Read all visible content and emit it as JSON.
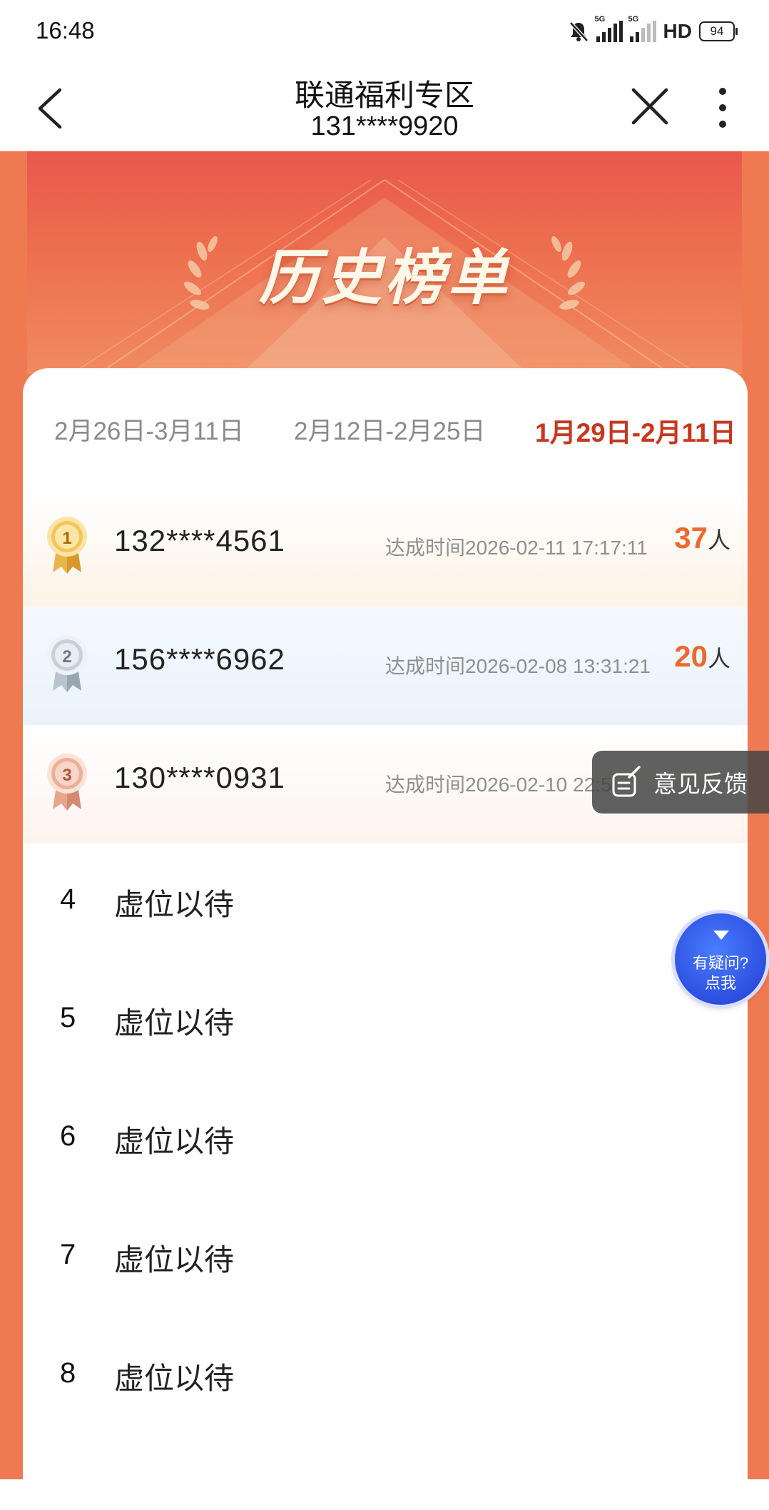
{
  "status_bar": {
    "time": "16:48",
    "network_1": "5G",
    "network_2": "5G",
    "hd": "HD",
    "battery": "94"
  },
  "header": {
    "title": "联通福利专区",
    "subtitle": "131****9920"
  },
  "banner": {
    "title": "历史榜单"
  },
  "tabs": [
    {
      "label": "2月26日-3月11日",
      "active": false
    },
    {
      "label": "2月12日-2月25日",
      "active": false
    },
    {
      "label": "1月29日-2月11日",
      "active": true
    }
  ],
  "leaderboard": {
    "top": [
      {
        "rank": "1",
        "phone": "132****4561",
        "time": "达成时间2026-02-11 17:17:11",
        "count": "37",
        "unit": "人"
      },
      {
        "rank": "2",
        "phone": "156****6962",
        "time": "达成时间2026-02-08 13:31:21",
        "count": "20",
        "unit": "人"
      },
      {
        "rank": "3",
        "phone": "130****0931",
        "time": "达成时间2026-02-10 22:5",
        "count": "",
        "unit": ""
      }
    ],
    "placeholders": [
      {
        "rank": "4",
        "label": "虚位以待"
      },
      {
        "rank": "5",
        "label": "虚位以待"
      },
      {
        "rank": "6",
        "label": "虚位以待"
      },
      {
        "rank": "7",
        "label": "虚位以待"
      },
      {
        "rank": "8",
        "label": "虚位以待"
      }
    ]
  },
  "floating": {
    "feedback_label": "意见反馈",
    "help_line1": "有疑问?",
    "help_line2": "点我"
  },
  "colors": {
    "page_bg": "#ef7a52",
    "accent_red": "#c6381f",
    "count_orange": "#ec6a2f"
  },
  "icons": {
    "back": "chevron-left-icon",
    "close": "close-icon",
    "more": "more-vertical-icon",
    "feedback": "edit-note-icon",
    "help": "help-arrow-icon"
  }
}
